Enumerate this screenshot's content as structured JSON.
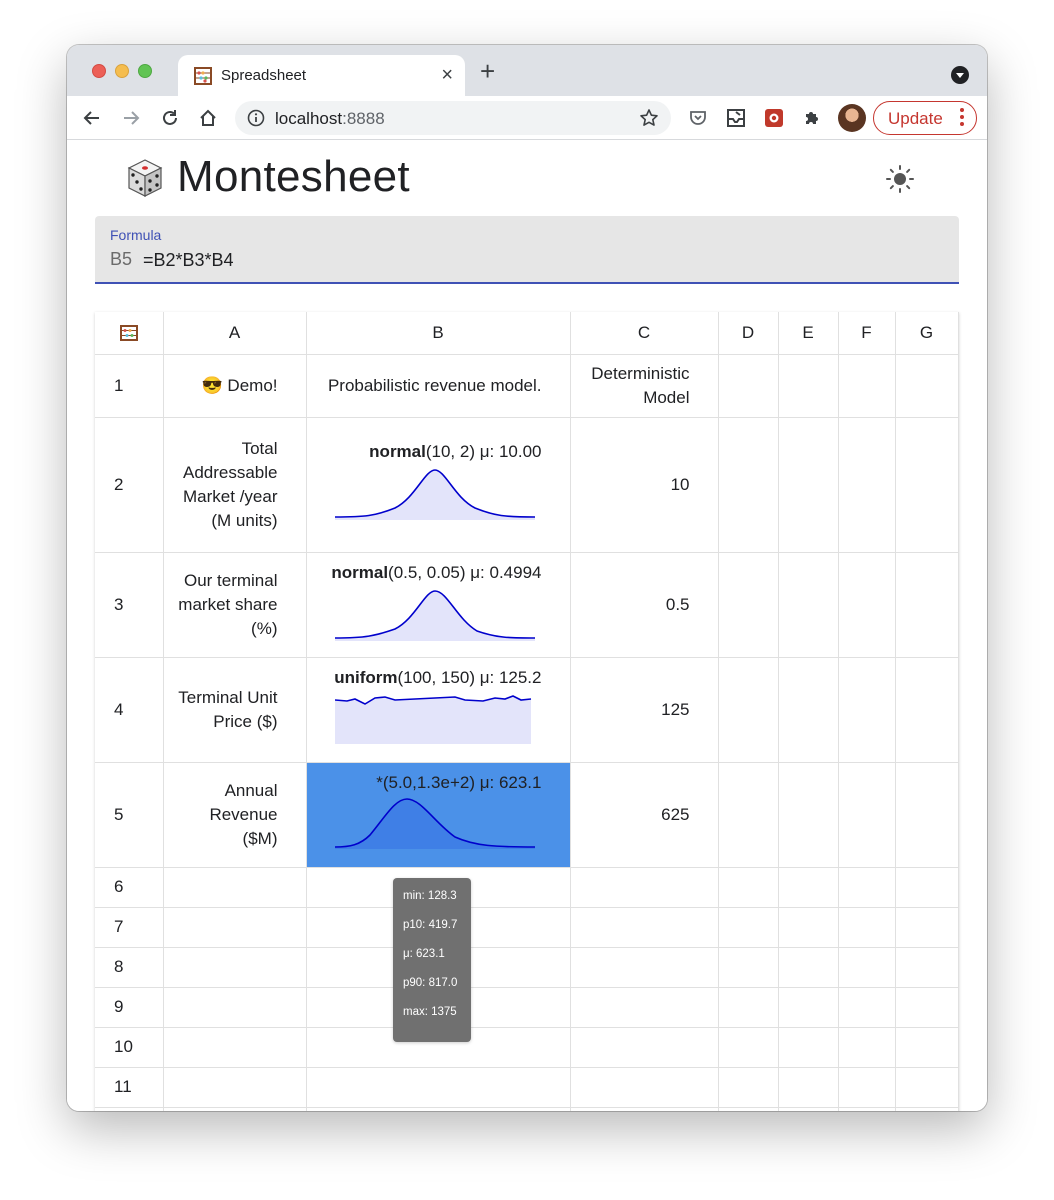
{
  "browser": {
    "tab_title": "Spreadsheet",
    "tab_close": "×",
    "new_tab": "+",
    "url_host": "localhost",
    "url_port": ":8888",
    "update_label": "Update"
  },
  "app": {
    "title": "Montesheet",
    "logo_icon": "dice-icon",
    "theme_icon": "sun-icon"
  },
  "formula": {
    "label": "Formula",
    "cell_ref": "B5",
    "value": "=B2*B3*B4"
  },
  "sheet": {
    "corner_icon": "abacus-icon",
    "columns": [
      "A",
      "B",
      "C",
      "D",
      "E",
      "F",
      "G"
    ],
    "row_numbers": [
      "1",
      "2",
      "3",
      "4",
      "5",
      "6",
      "7",
      "8",
      "9",
      "10",
      "11"
    ],
    "rows": [
      {
        "a": "😎 Demo!",
        "b": "Probabilistic revenue model.",
        "c": "Deterministic Model"
      },
      {
        "a": "Total Addressable Market /year (M units)",
        "b_fn": "normal",
        "b_args": "(10, 2) μ: 10.00",
        "c": "10"
      },
      {
        "a": "Our terminal market share (%)",
        "b_fn": "normal",
        "b_args": "(0.5, 0.05) μ: 0.4994",
        "c": "0.5"
      },
      {
        "a": "Terminal Unit Price ($)",
        "b_fn": "uniform",
        "b_args": "(100, 150) μ: 125.2",
        "c": "125"
      },
      {
        "a": "Annual Revenue ($M)",
        "b_fn": "",
        "b_args": "*(5.0,1.3e+2) μ: 623.1",
        "c": "625"
      }
    ]
  },
  "tooltip": {
    "min": "min: 128.3",
    "p10": "p10: 419.7",
    "mean": "μ: 623.1",
    "p90": "p90: 817.0",
    "max": "max: 1375"
  },
  "colors": {
    "selection": "#4b91e8",
    "accent": "#3f51b5",
    "spark_line": "#0000cc",
    "spark_fill": "#e3e4fa"
  }
}
